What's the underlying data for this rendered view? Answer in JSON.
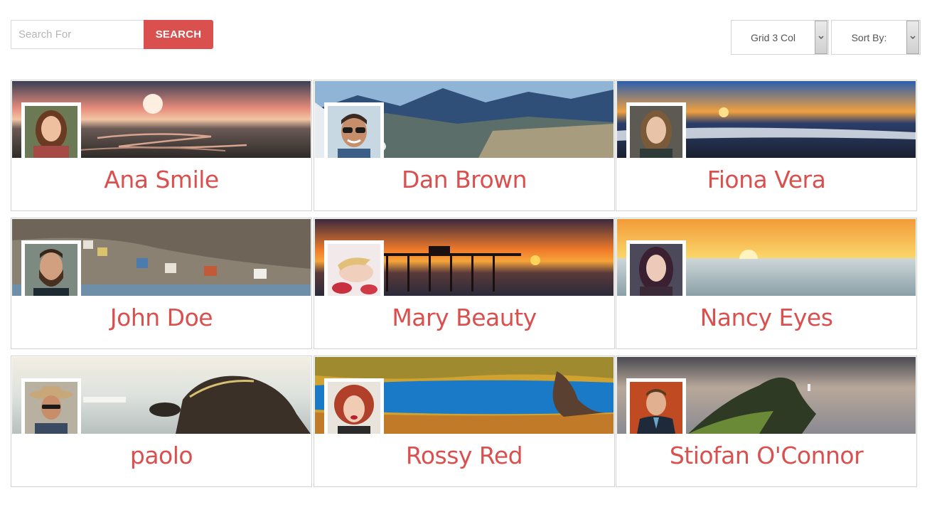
{
  "search": {
    "placeholder": "Search For",
    "button_label": "SEARCH"
  },
  "controls": {
    "layout_label": "Grid 3 Col",
    "sort_label": "Sort By:"
  },
  "colors": {
    "accent": "#d9504f"
  },
  "members": [
    {
      "name": "Ana Smile"
    },
    {
      "name": "Dan Brown"
    },
    {
      "name": "Fiona Vera"
    },
    {
      "name": "John Doe"
    },
    {
      "name": "Mary Beauty"
    },
    {
      "name": "Nancy Eyes"
    },
    {
      "name": "paolo"
    },
    {
      "name": "Rossy Red"
    },
    {
      "name": "Stiofan O'Connor"
    }
  ]
}
